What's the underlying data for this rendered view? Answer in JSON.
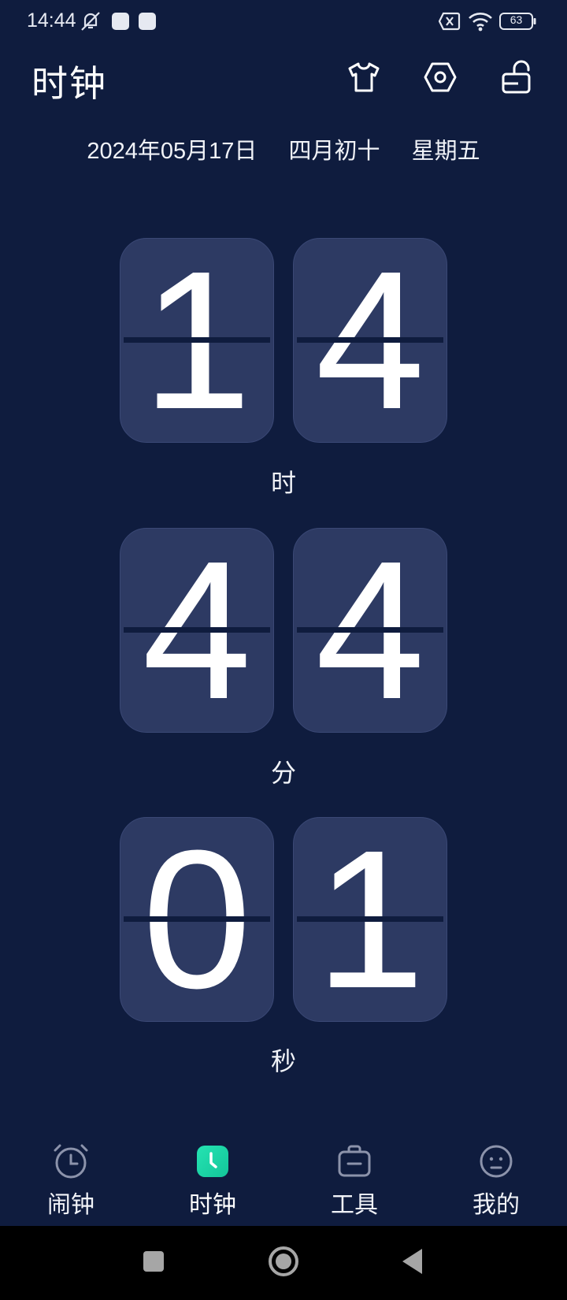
{
  "status_bar": {
    "time": "14:44",
    "battery": "63",
    "icons": [
      "notification-muted-icon",
      "app-notification-icon",
      "app-notification-icon",
      "no-sim-icon",
      "wifi-icon",
      "battery-icon"
    ]
  },
  "header": {
    "title": "时钟",
    "actions": [
      "theme-shirt-icon",
      "settings-hexagon-icon",
      "unlock-icon"
    ]
  },
  "date": {
    "gregorian": "2024年05月17日",
    "lunar": "四月初十",
    "weekday": "星期五"
  },
  "clock": {
    "hour": {
      "d1": "1",
      "d2": "4",
      "label": "时"
    },
    "minute": {
      "d1": "4",
      "d2": "4",
      "label": "分"
    },
    "second": {
      "d1": "0",
      "d2": "1",
      "label": "秒"
    }
  },
  "bottom_nav": {
    "items": [
      {
        "label": "闹钟",
        "icon": "alarm-clock-icon",
        "active": false
      },
      {
        "label": "时钟",
        "icon": "clock-icon",
        "active": true
      },
      {
        "label": "工具",
        "icon": "toolbox-icon",
        "active": false
      },
      {
        "label": "我的",
        "icon": "profile-face-icon",
        "active": false
      }
    ]
  },
  "colors": {
    "background": "#0f1c3e",
    "card": "#2d3a63",
    "accent": "#1fd8a8",
    "inactive_icon": "#8c93ab"
  }
}
